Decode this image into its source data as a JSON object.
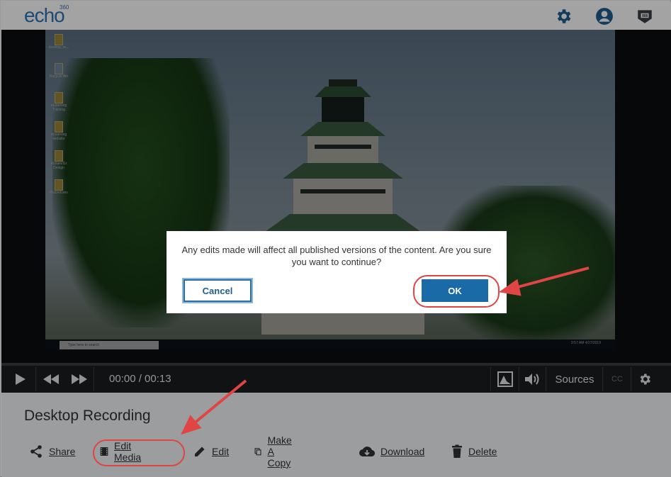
{
  "header": {
    "logo": "echo",
    "logo_sup": "360",
    "icons": [
      "gear-icon",
      "user-account-icon",
      "lti-badge-icon"
    ]
  },
  "player": {
    "time": "00:00 / 00:13",
    "sources_label": "Sources",
    "cc_label": "CC",
    "taskbar_search": "Type here to search",
    "taskbar_clock": "9:57 AM\n4/27/2019",
    "desktop_icons": [
      "desktop_re...",
      "Recycle Bin",
      "eLearning Training",
      "eLearning website",
      "eLearn/Gr Design",
      "Procedures"
    ]
  },
  "page": {
    "title": "Desktop Recording",
    "actions": [
      {
        "label": "Share",
        "icon": "share-icon"
      },
      {
        "label": "Edit Media",
        "icon": "film-strip-icon"
      },
      {
        "label": "Edit",
        "icon": "pencil-icon"
      },
      {
        "label": "Make A Copy",
        "icon": "copy-icon"
      },
      {
        "label": "Download",
        "icon": "cloud-download-icon"
      },
      {
        "label": "Delete",
        "icon": "trash-icon"
      }
    ]
  },
  "dialog": {
    "message": "Any edits made will affect all published versions of the content. Are you sure you want to continue?",
    "cancel_label": "Cancel",
    "ok_label": "OK"
  },
  "colors": {
    "brand": "#2e73b8",
    "ok_button": "#1a6aa8",
    "annotation": "#e04545"
  }
}
